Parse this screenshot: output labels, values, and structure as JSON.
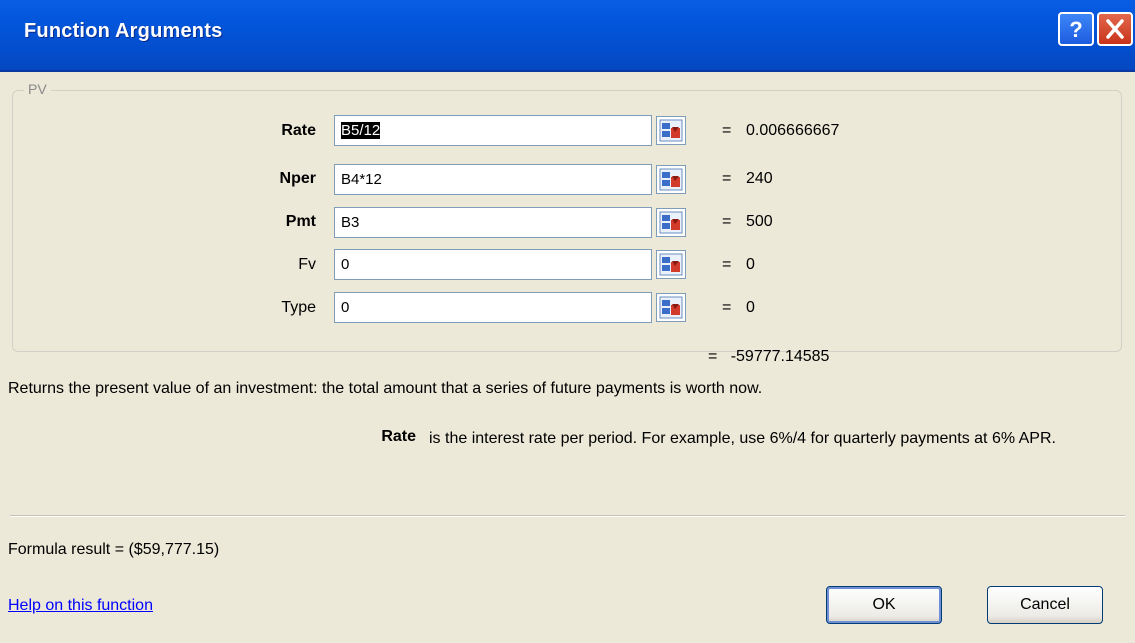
{
  "window": {
    "title": "Function Arguments"
  },
  "function_group": {
    "legend": "PV"
  },
  "arguments": [
    {
      "label": "Rate",
      "value": "B5/12",
      "result": "0.006666667",
      "bold": true
    },
    {
      "label": "Nper",
      "value": "B4*12",
      "result": "240",
      "bold": true
    },
    {
      "label": "Pmt",
      "value": "B3",
      "result": "500",
      "bold": true
    },
    {
      "label": "Fv",
      "value": "0",
      "result": "0",
      "bold": false
    },
    {
      "label": "Type",
      "value": "0",
      "result": "0",
      "bold": false
    }
  ],
  "equals_sign": "=",
  "function_result": "-59777.14585",
  "description": "Returns the present value of an investment: the total amount that a series of future payments is worth now.",
  "parameter_help": {
    "name": "Rate",
    "text": "is the interest rate per period. For example, use 6%/4 for quarterly payments at 6% APR."
  },
  "formula_result": "Formula result =   ($59,777.15)",
  "help_link": "Help on this function",
  "buttons": {
    "ok": "OK",
    "cancel": "Cancel"
  },
  "icons": {
    "help": "help-icon",
    "close": "close-icon",
    "collapse": "collapse-dialog-icon"
  },
  "colors": {
    "titlebar": "#0358dd",
    "link": "#0000ff",
    "background": "#ece9d8"
  }
}
